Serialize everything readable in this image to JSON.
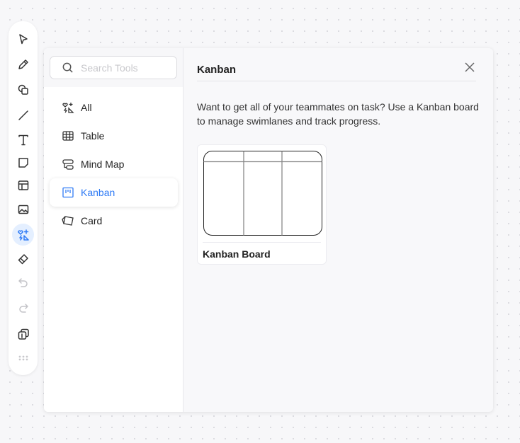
{
  "toolbar": {
    "tools": [
      {
        "icon": "select-arrow-icon"
      },
      {
        "icon": "pencil-icon"
      },
      {
        "icon": "shapes-icon"
      },
      {
        "icon": "line-icon"
      },
      {
        "icon": "text-icon"
      },
      {
        "icon": "sticky-note-icon"
      },
      {
        "icon": "layout-icon"
      },
      {
        "icon": "image-icon"
      },
      {
        "icon": "tools-icon",
        "active": true
      },
      {
        "icon": "eraser-icon"
      },
      {
        "icon": "undo-icon",
        "disabled": true
      },
      {
        "icon": "redo-icon",
        "disabled": true
      },
      {
        "icon": "layers-icon"
      },
      {
        "icon": "more-grid-icon"
      }
    ]
  },
  "search": {
    "placeholder": "Search Tools",
    "value": ""
  },
  "categories": [
    {
      "label": "All",
      "icon": "all-tools-icon"
    },
    {
      "label": "Table",
      "icon": "table-icon"
    },
    {
      "label": "Mind Map",
      "icon": "mind-map-icon"
    },
    {
      "label": "Kanban",
      "icon": "kanban-icon",
      "selected": true
    },
    {
      "label": "Card",
      "icon": "card-icon"
    }
  ],
  "detail": {
    "title": "Kanban",
    "description": "Want to get all of your teammates on task? Use a Kanban board to manage swimlanes and track progress.",
    "templates": [
      {
        "label": "Kanban Board"
      }
    ]
  },
  "colors": {
    "accent": "#2f7bf5",
    "active_bg": "#e4efff"
  }
}
